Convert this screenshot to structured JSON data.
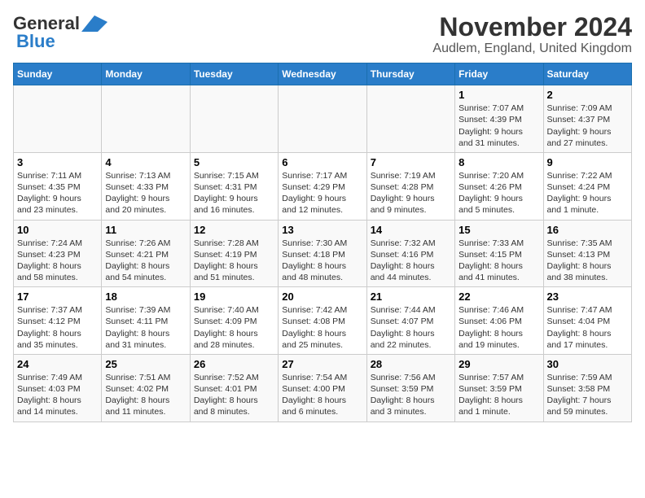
{
  "header": {
    "logo_general": "General",
    "logo_blue": "Blue",
    "title": "November 2024",
    "subtitle": "Audlem, England, United Kingdom"
  },
  "weekdays": [
    "Sunday",
    "Monday",
    "Tuesday",
    "Wednesday",
    "Thursday",
    "Friday",
    "Saturday"
  ],
  "weeks": [
    [
      {
        "day": "",
        "info": ""
      },
      {
        "day": "",
        "info": ""
      },
      {
        "day": "",
        "info": ""
      },
      {
        "day": "",
        "info": ""
      },
      {
        "day": "",
        "info": ""
      },
      {
        "day": "1",
        "info": "Sunrise: 7:07 AM\nSunset: 4:39 PM\nDaylight: 9 hours\nand 31 minutes."
      },
      {
        "day": "2",
        "info": "Sunrise: 7:09 AM\nSunset: 4:37 PM\nDaylight: 9 hours\nand 27 minutes."
      }
    ],
    [
      {
        "day": "3",
        "info": "Sunrise: 7:11 AM\nSunset: 4:35 PM\nDaylight: 9 hours\nand 23 minutes."
      },
      {
        "day": "4",
        "info": "Sunrise: 7:13 AM\nSunset: 4:33 PM\nDaylight: 9 hours\nand 20 minutes."
      },
      {
        "day": "5",
        "info": "Sunrise: 7:15 AM\nSunset: 4:31 PM\nDaylight: 9 hours\nand 16 minutes."
      },
      {
        "day": "6",
        "info": "Sunrise: 7:17 AM\nSunset: 4:29 PM\nDaylight: 9 hours\nand 12 minutes."
      },
      {
        "day": "7",
        "info": "Sunrise: 7:19 AM\nSunset: 4:28 PM\nDaylight: 9 hours\nand 9 minutes."
      },
      {
        "day": "8",
        "info": "Sunrise: 7:20 AM\nSunset: 4:26 PM\nDaylight: 9 hours\nand 5 minutes."
      },
      {
        "day": "9",
        "info": "Sunrise: 7:22 AM\nSunset: 4:24 PM\nDaylight: 9 hours\nand 1 minute."
      }
    ],
    [
      {
        "day": "10",
        "info": "Sunrise: 7:24 AM\nSunset: 4:23 PM\nDaylight: 8 hours\nand 58 minutes."
      },
      {
        "day": "11",
        "info": "Sunrise: 7:26 AM\nSunset: 4:21 PM\nDaylight: 8 hours\nand 54 minutes."
      },
      {
        "day": "12",
        "info": "Sunrise: 7:28 AM\nSunset: 4:19 PM\nDaylight: 8 hours\nand 51 minutes."
      },
      {
        "day": "13",
        "info": "Sunrise: 7:30 AM\nSunset: 4:18 PM\nDaylight: 8 hours\nand 48 minutes."
      },
      {
        "day": "14",
        "info": "Sunrise: 7:32 AM\nSunset: 4:16 PM\nDaylight: 8 hours\nand 44 minutes."
      },
      {
        "day": "15",
        "info": "Sunrise: 7:33 AM\nSunset: 4:15 PM\nDaylight: 8 hours\nand 41 minutes."
      },
      {
        "day": "16",
        "info": "Sunrise: 7:35 AM\nSunset: 4:13 PM\nDaylight: 8 hours\nand 38 minutes."
      }
    ],
    [
      {
        "day": "17",
        "info": "Sunrise: 7:37 AM\nSunset: 4:12 PM\nDaylight: 8 hours\nand 35 minutes."
      },
      {
        "day": "18",
        "info": "Sunrise: 7:39 AM\nSunset: 4:11 PM\nDaylight: 8 hours\nand 31 minutes."
      },
      {
        "day": "19",
        "info": "Sunrise: 7:40 AM\nSunset: 4:09 PM\nDaylight: 8 hours\nand 28 minutes."
      },
      {
        "day": "20",
        "info": "Sunrise: 7:42 AM\nSunset: 4:08 PM\nDaylight: 8 hours\nand 25 minutes."
      },
      {
        "day": "21",
        "info": "Sunrise: 7:44 AM\nSunset: 4:07 PM\nDaylight: 8 hours\nand 22 minutes."
      },
      {
        "day": "22",
        "info": "Sunrise: 7:46 AM\nSunset: 4:06 PM\nDaylight: 8 hours\nand 19 minutes."
      },
      {
        "day": "23",
        "info": "Sunrise: 7:47 AM\nSunset: 4:04 PM\nDaylight: 8 hours\nand 17 minutes."
      }
    ],
    [
      {
        "day": "24",
        "info": "Sunrise: 7:49 AM\nSunset: 4:03 PM\nDaylight: 8 hours\nand 14 minutes."
      },
      {
        "day": "25",
        "info": "Sunrise: 7:51 AM\nSunset: 4:02 PM\nDaylight: 8 hours\nand 11 minutes."
      },
      {
        "day": "26",
        "info": "Sunrise: 7:52 AM\nSunset: 4:01 PM\nDaylight: 8 hours\nand 8 minutes."
      },
      {
        "day": "27",
        "info": "Sunrise: 7:54 AM\nSunset: 4:00 PM\nDaylight: 8 hours\nand 6 minutes."
      },
      {
        "day": "28",
        "info": "Sunrise: 7:56 AM\nSunset: 3:59 PM\nDaylight: 8 hours\nand 3 minutes."
      },
      {
        "day": "29",
        "info": "Sunrise: 7:57 AM\nSunset: 3:59 PM\nDaylight: 8 hours\nand 1 minute."
      },
      {
        "day": "30",
        "info": "Sunrise: 7:59 AM\nSunset: 3:58 PM\nDaylight: 7 hours\nand 59 minutes."
      }
    ]
  ]
}
